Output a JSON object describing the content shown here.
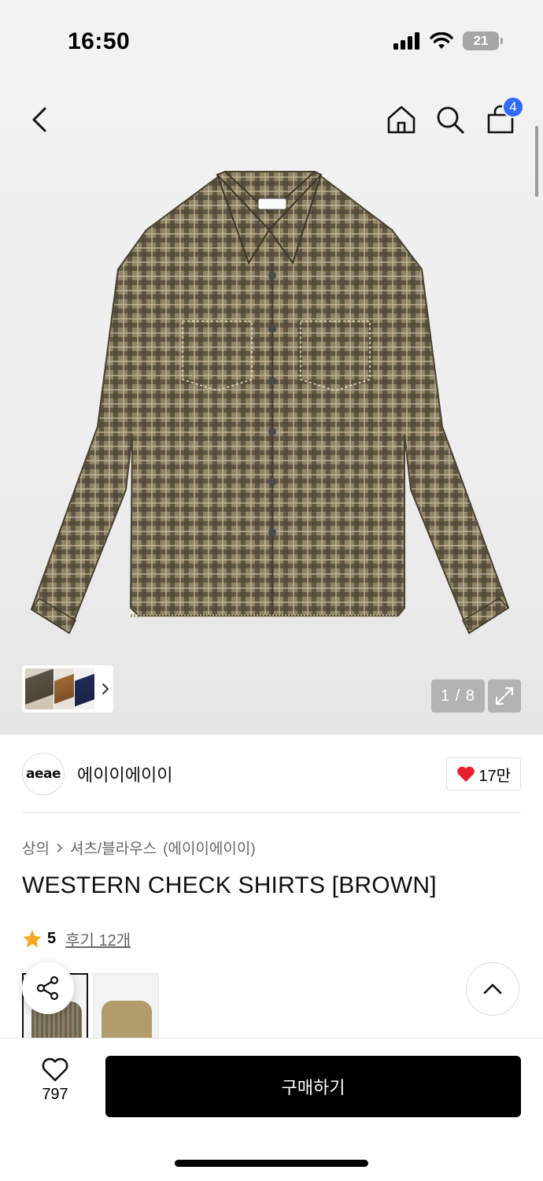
{
  "status_bar": {
    "time": "16:50",
    "battery": "21"
  },
  "nav": {
    "cart_count": "4"
  },
  "gallery": {
    "counter": "1 / 8",
    "image_alt": "brown check western shirt"
  },
  "brand": {
    "logo_text": "aeae",
    "name": "에이이에이이",
    "likes": "17만"
  },
  "breadcrumb": {
    "category": "상의",
    "subcategory": "셔츠/블라우스",
    "brand_suffix": "(에이이에이이)"
  },
  "product": {
    "title": "WESTERN CHECK SHIRTS [BROWN]",
    "rating": "5",
    "review_link": "후기 12개"
  },
  "bottom": {
    "wish_count": "797",
    "buy_label": "구매하기"
  },
  "colors": {
    "accent_badge": "#2f6bff",
    "heart": "#e8202e",
    "star": "#f5a623",
    "buy_button": "#000000"
  }
}
